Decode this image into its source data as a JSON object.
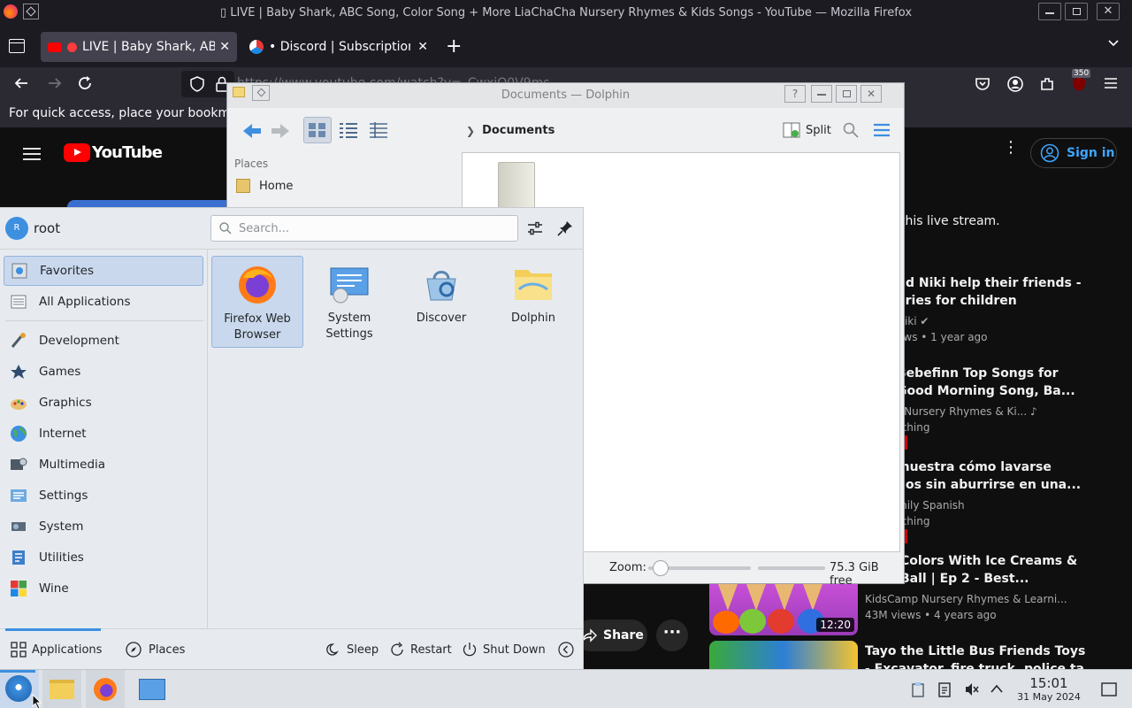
{
  "firefox": {
    "window_title": "▯ LIVE | Baby Shark, ABC Song, Color Song + More LiaChaCha Nursery Rhymes & Kids Songs - YouTube — Mozilla Firefox",
    "tabs": [
      {
        "label": "LIVE | Baby Shark, ABC",
        "active": true
      },
      {
        "label": "• Discord | Subscriptions",
        "active": false
      }
    ],
    "new_tab": "+",
    "url": "https://www.youtube.com/watch?v=_CwxiO0V9ms",
    "bookmarks_hint": "For quick access, place your bookmarks here on the bookmarks toolbar.",
    "extension_badge": "350"
  },
  "youtube": {
    "logo": "YouTube",
    "sign_in": "Sign in",
    "live_note": "this live stream.",
    "share": "Share",
    "recommendations": [
      {
        "title_line1": "nd Niki help their friends -",
        "title_line2": "ories for children",
        "meta1": "Niki ✔",
        "meta2": "ews • 1 year ago"
      },
      {
        "title_line1": "Bebefinn Top Songs for",
        "title_line2": "Good Morning Song, Ba...",
        "meta1": "- Nursery Rhymes & Ki... ♪",
        "meta2": "tching"
      },
      {
        "title_line1": "muestra cómo lavarse",
        "title_line2": "nos sin aburrirse en una...",
        "meta1": "mily Spanish",
        "meta2": "tching"
      },
      {
        "title_line1": "Colors With Ice Creams &",
        "title_line2": "Ball | Ep 2 - Best...",
        "meta1": "KidsCamp Nursery Rhymes & Learni...",
        "meta2": "43M views • 4 years ago",
        "duration": "12:20"
      },
      {
        "title_line1": "Tayo the Little Bus Friends Toys",
        "title_line2": "- Excavator, fire truck, police ta..."
      }
    ]
  },
  "dolphin": {
    "title": "Documents — Dolphin",
    "breadcrumb": "Documents",
    "split": "Split",
    "places_header": "Places",
    "places": [
      "Home"
    ],
    "zoom_label": "Zoom:",
    "zoom_value": 0.12,
    "free_space": "75.3 GiB free"
  },
  "launcher": {
    "user": "root",
    "user_initial": "R",
    "search_placeholder": "Search...",
    "categories": [
      "Favorites",
      "All Applications",
      "Development",
      "Games",
      "Graphics",
      "Internet",
      "Multimedia",
      "Settings",
      "System",
      "Utilities",
      "Wine"
    ],
    "favorites": [
      {
        "line1": "Firefox Web",
        "line2": "Browser"
      },
      {
        "line1": "System",
        "line2": "Settings"
      },
      {
        "line1": "Discover",
        "line2": ""
      },
      {
        "line1": "Dolphin",
        "line2": ""
      }
    ],
    "tabs": {
      "applications": "Applications",
      "places": "Places"
    },
    "power": {
      "sleep": "Sleep",
      "restart": "Restart",
      "shutdown": "Shut Down"
    }
  },
  "taskbar": {
    "time": "15:01",
    "date": "31 May 2024"
  }
}
